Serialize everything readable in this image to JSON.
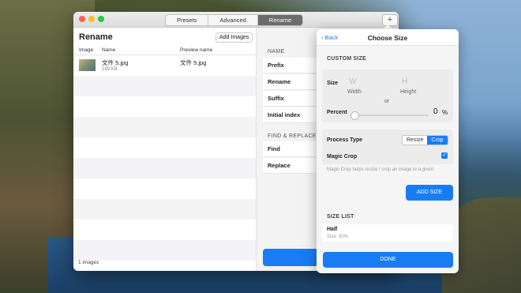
{
  "window": {
    "tabs": [
      "Presets",
      "Advanced",
      "Rename"
    ],
    "active_tab": "Rename",
    "plus_icon": "+"
  },
  "left_panel": {
    "title": "Rename",
    "add_images_label": "Add Images",
    "columns": [
      "Image",
      "Name",
      "Preview name"
    ],
    "rows": [
      {
        "name": "文件 5.jpg",
        "size": "189 KB",
        "preview": "文件 5.jpg"
      }
    ],
    "footer_count": "1 images"
  },
  "right_panel": {
    "name_section": "NAME",
    "fields": [
      "Prefix",
      "Rename",
      "Suffix",
      "Initial index"
    ],
    "find_replace_section": "FIND & REPLACE",
    "find_fields": [
      "Find",
      "Replace"
    ]
  },
  "popover": {
    "back_label": "Back",
    "title": "Choose Size",
    "custom_size_label": "CUSTOM SIZE",
    "size_label": "Size",
    "width_placeholder": "W",
    "width_caption": "Width",
    "height_placeholder": "H",
    "height_caption": "Height",
    "or_label": "or",
    "percent_label": "Percent",
    "percent_value": "0",
    "percent_unit": "%",
    "process_type_label": "Process Type",
    "process_options": [
      "Resize",
      "Crop"
    ],
    "process_selected": "Crop",
    "magic_crop_label": "Magic Crop",
    "magic_crop_checked": true,
    "hint_text": "Magic Crop helps resize / crop an image to a given",
    "add_size_label": "ADD SIZE",
    "size_list_label": "SIZE LIST",
    "size_list": [
      {
        "name": "Half",
        "detail": "Size: 50%"
      }
    ],
    "done_label": "DONE"
  }
}
